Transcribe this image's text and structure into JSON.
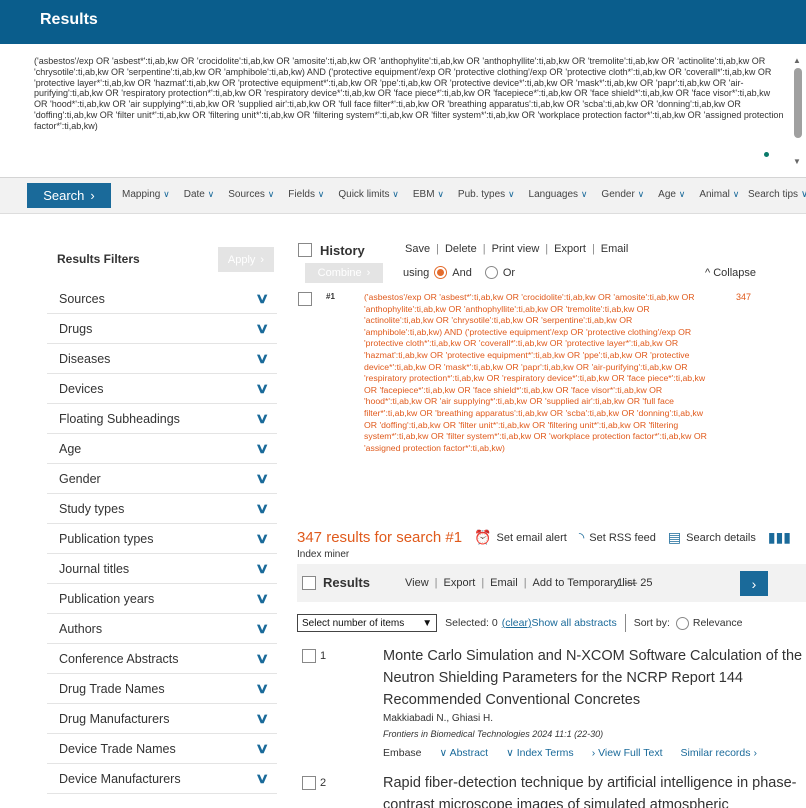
{
  "header": {
    "title": "Results"
  },
  "query": {
    "text": "('asbestos'/exp OR 'asbest*':ti,ab,kw OR 'crocidolite':ti,ab,kw OR 'amosite':ti,ab,kw OR 'anthophylite':ti,ab,kw OR 'anthophyllite':ti,ab,kw OR 'tremolite':ti,ab,kw OR 'actinolite':ti,ab,kw OR 'chrysotile':ti,ab,kw OR 'serpentine':ti,ab,kw OR 'amphibole':ti,ab,kw) AND ('protective equipment'/exp OR 'protective clothing'/exp OR 'protective cloth*':ti,ab,kw OR 'coverall*':ti,ab,kw OR 'protective layer*':ti,ab,kw OR 'hazmat':ti,ab,kw OR 'protective equipment*':ti,ab,kw OR 'ppe':ti,ab,kw OR 'protective device*':ti,ab,kw OR 'mask*':ti,ab,kw OR 'papr':ti,ab,kw OR 'air-purifying':ti,ab,kw OR 'respiratory protection*':ti,ab,kw OR 'respiratory device*':ti,ab,kw OR 'face piece*':ti,ab,kw OR 'facepiece*':ti,ab,kw OR 'face shield*':ti,ab,kw OR 'face visor*':ti,ab,kw OR 'hood*':ti,ab,kw OR 'air supplying*':ti,ab,kw OR 'supplied air':ti,ab,kw OR 'full face filter*':ti,ab,kw OR 'breathing apparatus':ti,ab,kw OR 'scba':ti,ab,kw OR 'donning':ti,ab,kw OR 'doffing':ti,ab,kw OR 'filter unit*':ti,ab,kw OR 'filtering unit*':ti,ab,kw OR 'filtering system*':ti,ab,kw OR 'filter system*':ti,ab,kw OR 'workplace protection factor*':ti,ab,kw OR 'assigned protection factor*':ti,ab,kw)"
  },
  "search_bar": {
    "search_label": "Search",
    "options": [
      "Mapping",
      "Date",
      "Sources",
      "Fields",
      "Quick limits",
      "EBM",
      "Pub. types",
      "Languages",
      "Gender",
      "Age",
      "Animal"
    ],
    "tips": "Search tips"
  },
  "filters": {
    "title": "Results Filters",
    "apply": "Apply",
    "items": [
      "Sources",
      "Drugs",
      "Diseases",
      "Devices",
      "Floating Subheadings",
      "Age",
      "Gender",
      "Study types",
      "Publication types",
      "Journal titles",
      "Publication years",
      "Authors",
      "Conference Abstracts",
      "Drug Trade Names",
      "Drug Manufacturers",
      "Device Trade Names",
      "Device Manufacturers"
    ]
  },
  "history": {
    "title": "History",
    "actions": [
      "Save",
      "Delete",
      "Print view",
      "Export",
      "Email"
    ],
    "combine": "Combine",
    "using": "using",
    "and": "And",
    "or": "Or",
    "collapse": "Collapse",
    "row_num": "#1",
    "row_count": "347"
  },
  "summary": {
    "count_text": "347 results for search #1",
    "email_alert": "Set email alert",
    "rss": "Set RSS feed",
    "details": "Search details",
    "index_miner": "Index miner"
  },
  "results_bar": {
    "title": "Results",
    "actions": [
      "View",
      "Export",
      "Email",
      "Add to Temporary list"
    ],
    "pager": "1 — 25"
  },
  "select_row": {
    "select_label": "Select number of items",
    "selected": "Selected: 0",
    "clear": "(clear)",
    "show_all": "Show all abstracts",
    "sort_by": "Sort by:",
    "relevance": "Relevance"
  },
  "items": [
    {
      "num": "1",
      "title": "Monte Carlo Simulation and N-XCOM Software Calculation of the Neutron Shielding Parameters for the NCRP Report 144 Recommended Conventional Concretes",
      "authors": "Makkiabadi N., Ghiasi H.",
      "journal": "Frontiers in Biomedical Technologies 2024 11:1 (22-30)",
      "links": [
        "Embase",
        "Abstract",
        "Index Terms",
        "View Full Text",
        "Similar records"
      ]
    },
    {
      "num": "2",
      "title": "Rapid fiber-detection technique by artificial intelligence in phase-contrast microscope images of simulated atmospheric"
    }
  ]
}
